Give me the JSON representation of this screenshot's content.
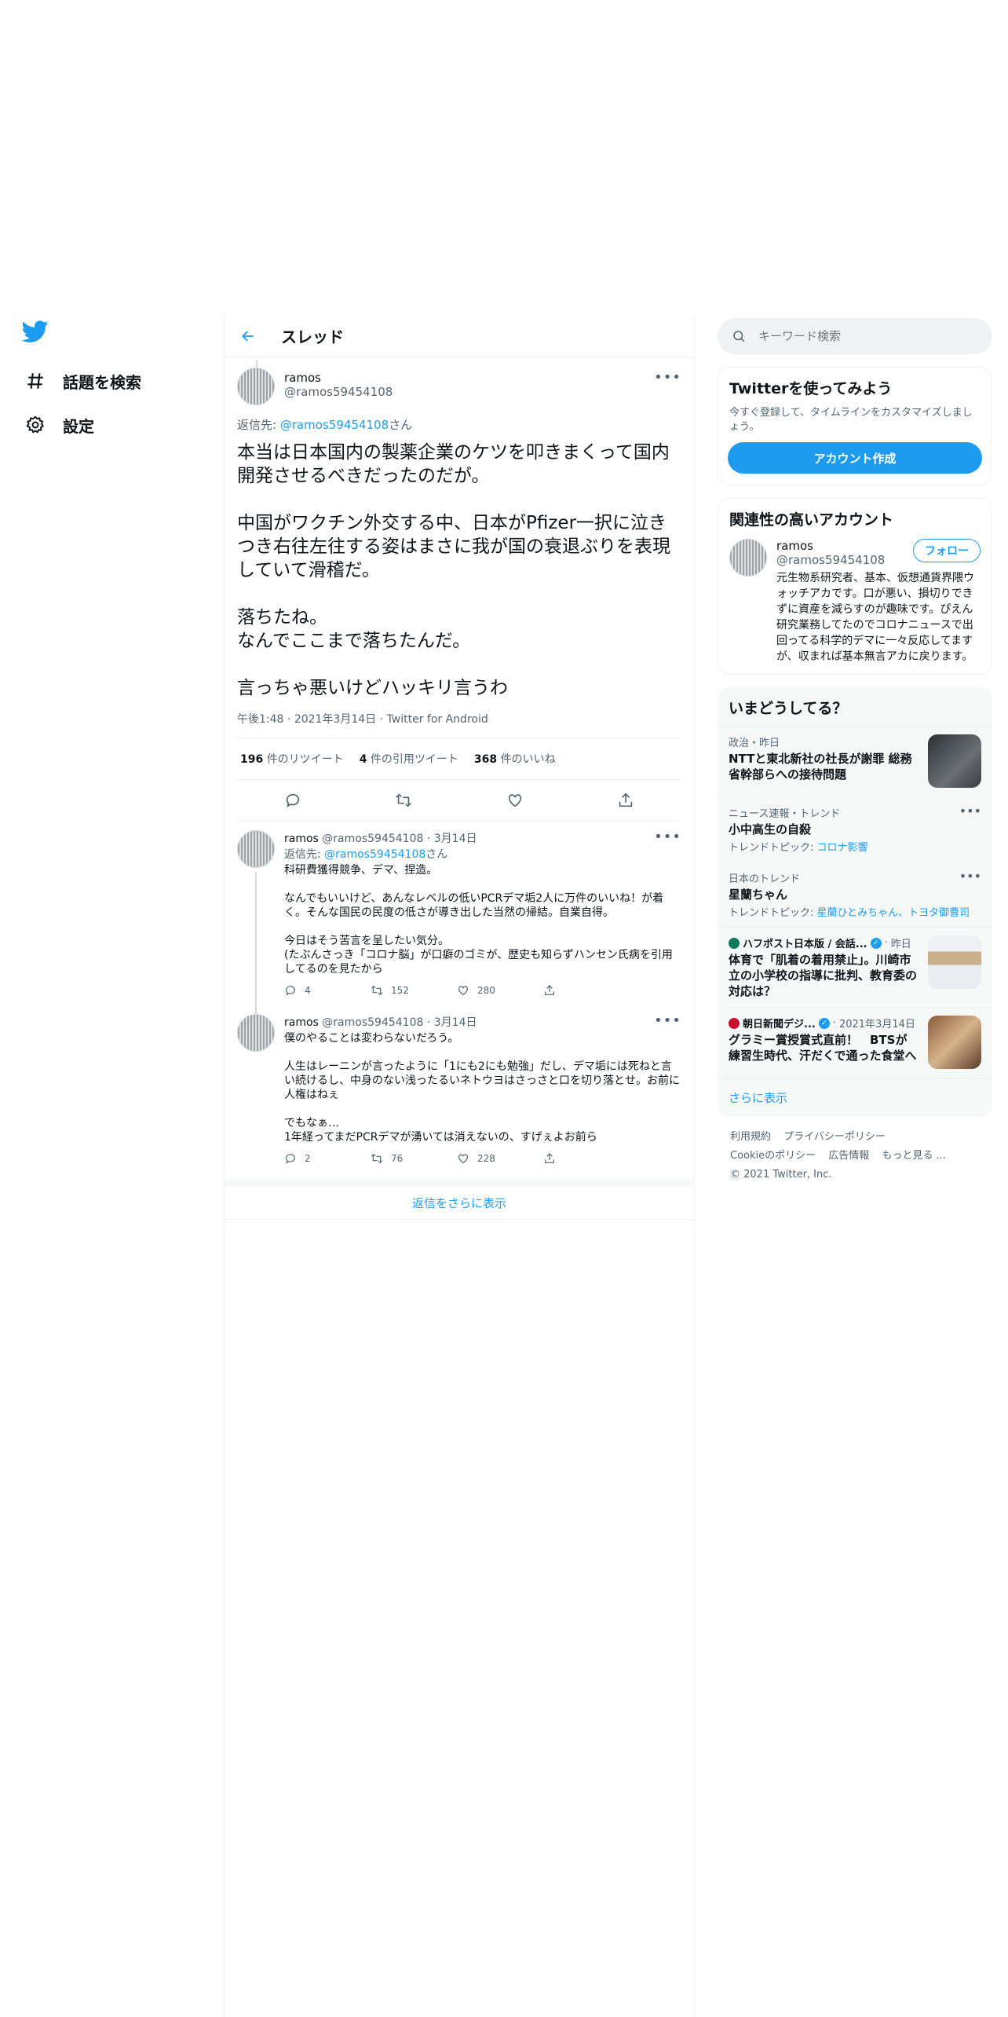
{
  "nav": {
    "explore_label": "話題を検索",
    "settings_label": "設定"
  },
  "header": {
    "title": "スレッド"
  },
  "tweet": {
    "name": "ramos",
    "handle": "@ramos59454108",
    "reply_prefix": "返信先: ",
    "reply_to": "@ramos59454108",
    "reply_suffix": "さん",
    "text": "本当は日本国内の製薬企業のケツを叩きまくって国内開発させるべきだったのだが。\n\n中国がワクチン外交する中、日本がPfizer一択に泣きつき右往左往する姿はまさに我が国の衰退ぶりを表現していて滑稽だ。\n\n落ちたね。\nなんでここまで落ちたんだ。\n\n言っちゃ悪いけどハッキリ言うわ",
    "time": "午後1:48",
    "date": "2021年3月14日",
    "client": "Twitter for Android",
    "retweets": "196",
    "retweets_label": "件のリツイート",
    "quotes": "4",
    "quotes_label": "件の引用ツイート",
    "likes": "368",
    "likes_label": "件のいいね"
  },
  "replies": [
    {
      "name": "ramos",
      "handle": "@ramos59454108",
      "date": "3月14日",
      "reply_prefix": "返信先: ",
      "reply_to": "@ramos59454108",
      "reply_suffix": "さん",
      "text": "科研費獲得競争、デマ、捏造。\n\nなんでもいいけど、あんなレベルの低いPCRデマ垢2人に万件のいいね！が着く。そんな国民の民度の低さが導き出した当然の帰結。自業自得。\n\n今日はそう苦言を呈したい気分。\n(たぶんさっき「コロナ脳」が口癖のゴミが、歴史も知らずハンセン氏病を引用してるのを見たから",
      "replies": "4",
      "retweets": "152",
      "likes": "280"
    },
    {
      "name": "ramos",
      "handle": "@ramos59454108",
      "date": "3月14日",
      "text": "僕のやることは変わらないだろう。\n\n人生はレーニンが言ったように「1にも2にも勉強」だし、デマ垢には死ねと言い続けるし、中身のない浅ったるいネトウヨはさっさと口を切り落とせ。お前に人権はねぇ\n\nでもなぁ…\n1年経ってまだPCRデマが湧いては消えないの、すげぇよお前ら",
      "replies": "2",
      "retweets": "76",
      "likes": "228"
    }
  ],
  "show_more_replies": "返信をさらに表示",
  "search": {
    "placeholder": "キーワード検索"
  },
  "signup": {
    "title": "Twitterを使ってみよう",
    "desc": "今すぐ登録して、タイムラインをカスタマイズしましょう。",
    "button": "アカウント作成"
  },
  "related": {
    "title": "関連性の高いアカウント",
    "name": "ramos",
    "handle": "@ramos59454108",
    "follow": "フォロー",
    "bio": "元生物系研究者、基本、仮想通貨界隈ウォッチアカです。口が悪い、損切りできずに資産を減らすのが趣味です。ぴえん 研究業務してたのでコロナニュースで出回ってる科学的デマに一々反応してますが、収まれば基本無言アカに戻ります。"
  },
  "trends": {
    "title": "いまどうしてる？",
    "items": [
      {
        "cat": "政治・昨日",
        "title": "NTTと東北新社の社長が謝罪 総務省幹部らへの接待問題",
        "thumb": true
      },
      {
        "cat": "ニュース速報・トレンド",
        "title": "小中高生の自殺",
        "sub_prefix": "トレンドトピック: ",
        "sub": "コロナ影響"
      },
      {
        "cat": "日本のトレンド",
        "title": "星蘭ちゃん",
        "sub_prefix": "トレンドトピック: ",
        "sub": "星蘭ひとみちゃん、トヨタ御曹司"
      },
      {
        "source": "ハフポスト日本版 / 会話...",
        "when": "昨日",
        "title": "体育で「肌着の着用禁止」。川崎市立の小学校の指導に批判、教育委の対応は？",
        "thumb": true
      },
      {
        "source": "朝日新聞デジ...",
        "when": "2021年3月14日",
        "title": "グラミー賞授賞式直前！　BTSが練習生時代、汗だくで通った食堂へ",
        "thumb": true
      }
    ],
    "more": "さらに表示"
  },
  "footer": {
    "terms": "利用規約",
    "privacy": "プライバシーポリシー",
    "cookie": "Cookieのポリシー",
    "ads": "広告情報",
    "more": "もっと見る ...",
    "copyright": "© 2021 Twitter, Inc."
  },
  "colors": {
    "accent": "#1d9bf0",
    "text": "#0f1419",
    "muted": "#536471"
  }
}
